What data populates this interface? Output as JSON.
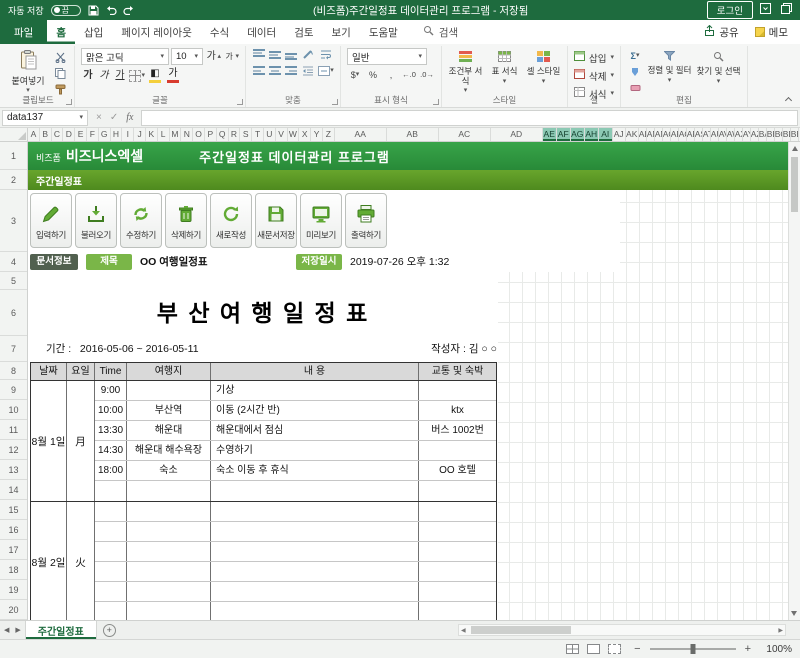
{
  "titlebar": {
    "autosave_label": "자동 저장",
    "autosave_state": "끔",
    "title": "(비즈폼)주간일정표 데이터관리 프로그램 - 저장됨",
    "login_label": "로그인"
  },
  "glyphs": {
    "caret": "▾",
    "caret_up": "▴",
    "cancel": "×",
    "enter": "✓",
    "fx": "fx",
    "prev": "◀",
    "next": "▶",
    "plus": "+",
    "minus": "−",
    "add": "+",
    "sigma": "Σ",
    "currency": "$",
    "percent": "%",
    "comma": ",",
    "dec_inc": "←.0",
    "dec_dec": ".0→",
    "ga": "가"
  },
  "ribbon": {
    "tabs": [
      "파일",
      "홈",
      "삽입",
      "페이지 레이아웃",
      "수식",
      "데이터",
      "검토",
      "보기",
      "도움말"
    ],
    "search_label": "검색",
    "share_label": "공유",
    "memo_label": "메모",
    "clipboard": {
      "label": "클립보드",
      "paste": "붙여넣기"
    },
    "font": {
      "label": "글꼴",
      "name": "맑은 고딕",
      "size": "10"
    },
    "alignment": {
      "label": "맞춤"
    },
    "number": {
      "label": "표시 형식",
      "format": "일반"
    },
    "styles": {
      "label": "스타일",
      "conditional": "조건부 서식",
      "table": "표 서식",
      "cell": "셀 스타일"
    },
    "cells": {
      "label": "셀",
      "insert": "삽입",
      "delete": "삭제",
      "format": "서식"
    },
    "editing": {
      "label": "편집",
      "sort": "정렬 및 필터",
      "find": "찾기 및 선택"
    }
  },
  "formula_bar": {
    "name_box": "data137"
  },
  "sheet": {
    "columns": [
      "A",
      "B",
      "C",
      "D",
      "E",
      "F",
      "G",
      "H",
      "I",
      "J",
      "K",
      "L",
      "M",
      "N",
      "O",
      "P",
      "Q",
      "R",
      "S",
      "T",
      "U",
      "V",
      "W",
      "X",
      "Y",
      "Z",
      "AA",
      "AB",
      "AC",
      "AD",
      "AE",
      "AF",
      "AG",
      "AH",
      "AI",
      "AJ",
      "AK",
      "AL",
      "AM",
      "AN",
      "AO",
      "AP",
      "AQ",
      "AR",
      "AS",
      "AT",
      "AU",
      "AV",
      "AW",
      "AX",
      "AY",
      "AZ",
      "BA",
      "BB",
      "BC",
      "BD",
      "BE"
    ],
    "selected_columns": [
      "AE",
      "AF",
      "AG",
      "AH",
      "AI"
    ]
  },
  "document": {
    "banner": {
      "brand_small": "비즈폼",
      "brand_large": "비즈니스엑셀",
      "title": "주간일정표 데이터관리 프로그램"
    },
    "subbar_title": "주간일정표",
    "toolbar_buttons": [
      {
        "name": "input-button",
        "icon": "pencil-icon",
        "label": "입력하기"
      },
      {
        "name": "load-button",
        "icon": "import-icon",
        "label": "불러오기"
      },
      {
        "name": "modify-button",
        "icon": "refresh-icon",
        "label": "수정하기"
      },
      {
        "name": "delete-button",
        "icon": "trash-icon",
        "label": "삭제하기"
      },
      {
        "name": "new-button",
        "icon": "renew-icon",
        "label": "새로작성"
      },
      {
        "name": "save-as-button",
        "icon": "save-doc-icon",
        "label": "새문서저장"
      },
      {
        "name": "preview-button",
        "icon": "monitor-icon",
        "label": "미리보기"
      },
      {
        "name": "print-button",
        "icon": "printer-icon",
        "label": "출력하기"
      }
    ],
    "docinfo": {
      "doc_label": "문서정보",
      "title_label": "제목",
      "title_value": "OO 여행일정표",
      "saved_label": "저장일시",
      "saved_value": "2019-07-26  오후 1:32"
    },
    "main_title": "부 산 여 행 일 정 표",
    "period_label": "기간 :",
    "period_value": "2016-05-06   ~   2016-05-11",
    "author_label": "작성자 :",
    "author_value": "김 ○ ○",
    "table": {
      "headers": [
        "날짜",
        "요일",
        "Time",
        "여행지",
        "내 용",
        "교통 및 숙박"
      ],
      "day_blocks": [
        {
          "date": "8월 1일",
          "day": "月",
          "rows": [
            {
              "time": "9:00",
              "place": "",
              "content": "기상",
              "transport": ""
            },
            {
              "time": "10:00",
              "place": "부산역",
              "content": "이동 (2시간 반)",
              "transport": "ktx"
            },
            {
              "time": "13:30",
              "place": "해운대",
              "content": "해운대에서 점심",
              "transport": "버스 1002번"
            },
            {
              "time": "14:30",
              "place": "해운대 해수욕장",
              "content": "수영하기",
              "transport": ""
            },
            {
              "time": "18:00",
              "place": "숙소",
              "content": "숙소 이동 후 휴식",
              "transport": "OO 호텔"
            },
            {
              "time": "",
              "place": "",
              "content": "",
              "transport": ""
            }
          ]
        },
        {
          "date": "8월 2일",
          "day": "火",
          "rows": [
            {
              "time": "",
              "place": "",
              "content": "",
              "transport": ""
            },
            {
              "time": "",
              "place": "",
              "content": "",
              "transport": ""
            },
            {
              "time": "",
              "place": "",
              "content": "",
              "transport": ""
            },
            {
              "time": "",
              "place": "",
              "content": "",
              "transport": ""
            },
            {
              "time": "",
              "place": "",
              "content": "",
              "transport": ""
            },
            {
              "time": "",
              "place": "",
              "content": "",
              "transport": ""
            }
          ]
        }
      ]
    }
  },
  "sheet_tabs": {
    "active_tab": "주간일정표"
  },
  "status_bar": {
    "zoom": "100%"
  }
}
